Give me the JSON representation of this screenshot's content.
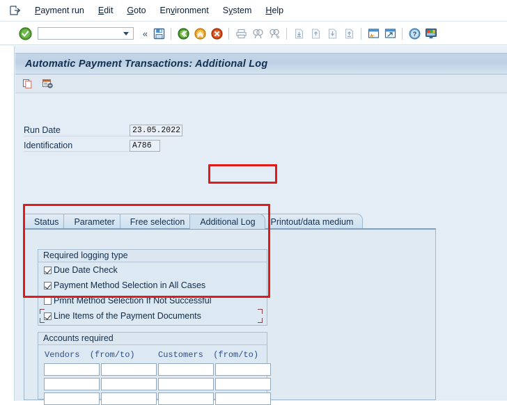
{
  "menu": {
    "back_icon": "back-arrow-icon",
    "items": [
      {
        "label": "Payment run",
        "accel": "P"
      },
      {
        "label": "Edit",
        "accel": "E"
      },
      {
        "label": "Goto",
        "accel": "G"
      },
      {
        "label": "Environment",
        "accel": "v"
      },
      {
        "label": "System",
        "accel": "y"
      },
      {
        "label": "Help",
        "accel": "H"
      }
    ]
  },
  "toolbar": {
    "enter_icon": "green-check-icon",
    "command_field_value": "",
    "command_field_placeholder": "",
    "dropdown_icon": "chevron-down-icon",
    "collapse_icon": "«",
    "icons": [
      "save-icon",
      "back-green-icon",
      "exit-yellow-icon",
      "cancel-red-icon",
      "print-icon",
      "find-icon",
      "find-next-icon",
      "first-page-icon",
      "previous-page-icon",
      "next-page-icon",
      "last-page-icon",
      "create-session-icon",
      "create-shortcut-icon",
      "help-icon",
      "customize-layout-icon"
    ]
  },
  "window": {
    "title": "Automatic Payment Transactions: Additional Log",
    "app_toolbar_icons": [
      "copy-icon",
      "status-list-icon"
    ]
  },
  "header_fields": [
    {
      "label": "Run Date",
      "value": "23.05.2022"
    },
    {
      "label": "Identification",
      "value": "A786"
    }
  ],
  "tabs": [
    {
      "label": "Status",
      "active": false
    },
    {
      "label": "Parameter",
      "active": false
    },
    {
      "label": "Free selection",
      "active": false
    },
    {
      "label": "Additional Log",
      "active": true
    },
    {
      "label": "Printout/data medium",
      "active": false
    }
  ],
  "logging_group": {
    "title": "Required logging type",
    "options": [
      {
        "label": "Due Date Check",
        "checked": true,
        "focused": false
      },
      {
        "label": "Payment Method Selection in All Cases",
        "checked": true,
        "focused": false
      },
      {
        "label": "Pmnt Method Selection If Not Successful",
        "checked": false,
        "focused": false
      },
      {
        "label": "Line Items of the Payment Documents",
        "checked": true,
        "focused": true
      }
    ]
  },
  "accounts_group": {
    "title": "Accounts required",
    "columns": [
      "Vendors  (from/to)",
      "Customers  (from/to)"
    ],
    "rows": [
      [
        "",
        "",
        "",
        ""
      ],
      [
        "",
        "",
        "",
        ""
      ],
      [
        "",
        "",
        "",
        ""
      ]
    ]
  },
  "annotations": {
    "accent_color": "#e01b1b",
    "highlighted_tab": "Additional Log",
    "highlighted_group": "Required logging type"
  }
}
